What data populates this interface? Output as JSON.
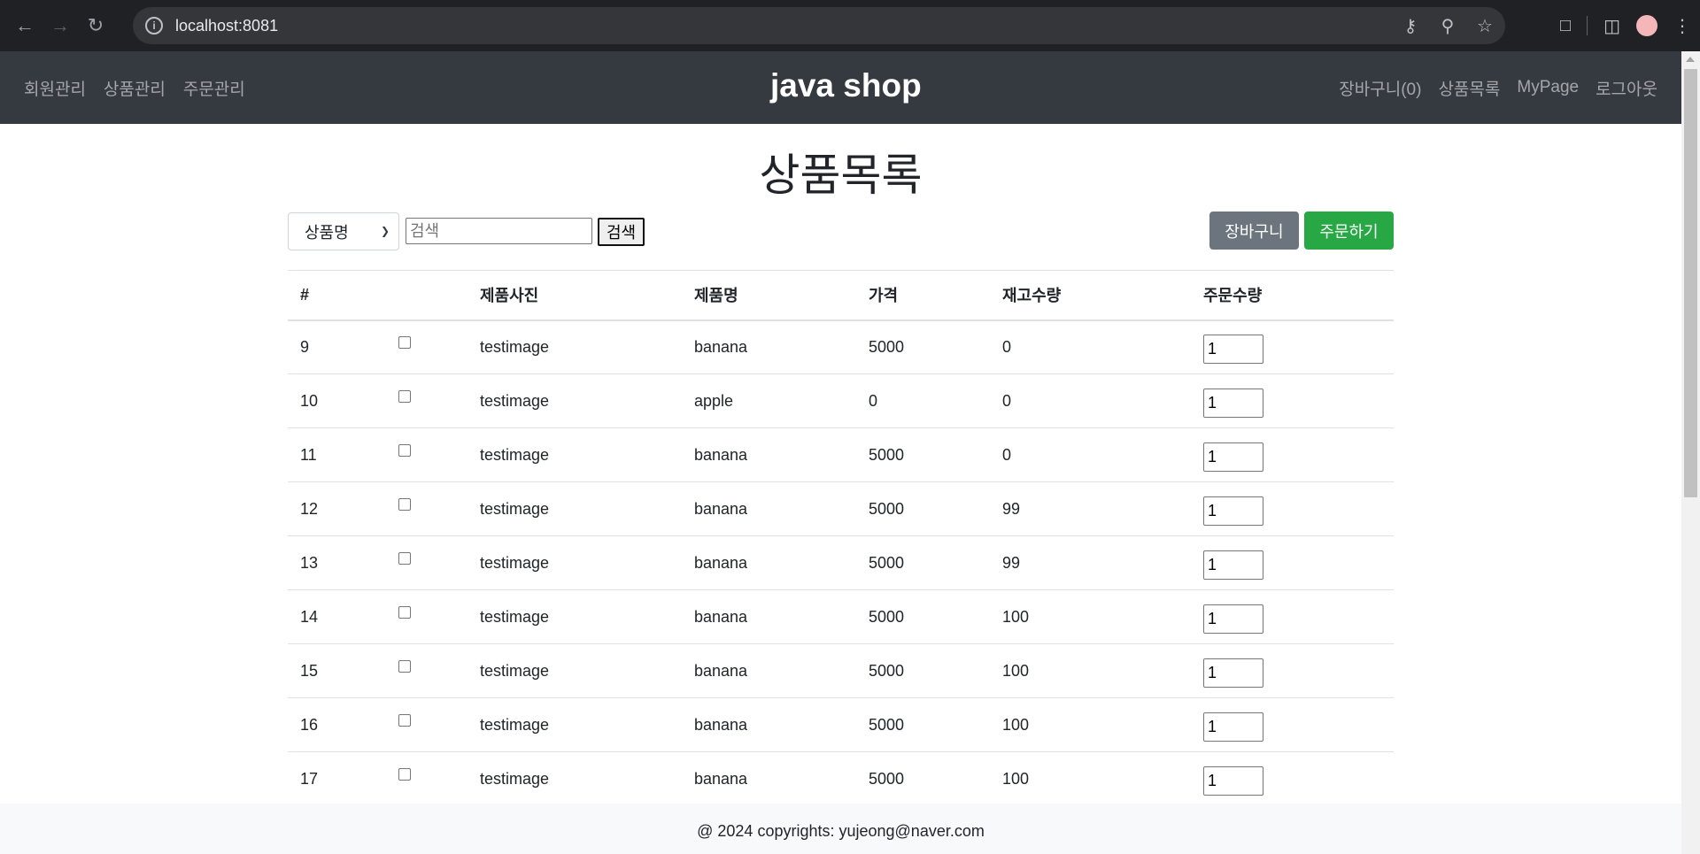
{
  "browser": {
    "url": "localhost:8081"
  },
  "nav": {
    "brand": "java shop",
    "left_links": [
      "회원관리",
      "상품관리",
      "주문관리"
    ],
    "right_links": [
      "장바구니(0)",
      "상품목록",
      "MyPage",
      "로그아웃"
    ]
  },
  "page": {
    "title": "상품목록"
  },
  "search": {
    "select_value": "상품명",
    "placeholder": "검색",
    "button_label": "검색"
  },
  "actions": {
    "cart_label": "장바구니",
    "order_label": "주문하기"
  },
  "table": {
    "headers": [
      "#",
      "",
      "제품사진",
      "제품명",
      "가격",
      "재고수량",
      "주문수량"
    ],
    "rows": [
      {
        "id": "9",
        "image": "testimage",
        "name": "banana",
        "price": "5000",
        "stock": "0",
        "qty": "1"
      },
      {
        "id": "10",
        "image": "testimage",
        "name": "apple",
        "price": "0",
        "stock": "0",
        "qty": "1"
      },
      {
        "id": "11",
        "image": "testimage",
        "name": "banana",
        "price": "5000",
        "stock": "0",
        "qty": "1"
      },
      {
        "id": "12",
        "image": "testimage",
        "name": "banana",
        "price": "5000",
        "stock": "99",
        "qty": "1"
      },
      {
        "id": "13",
        "image": "testimage",
        "name": "banana",
        "price": "5000",
        "stock": "99",
        "qty": "1"
      },
      {
        "id": "14",
        "image": "testimage",
        "name": "banana",
        "price": "5000",
        "stock": "100",
        "qty": "1"
      },
      {
        "id": "15",
        "image": "testimage",
        "name": "banana",
        "price": "5000",
        "stock": "100",
        "qty": "1"
      },
      {
        "id": "16",
        "image": "testimage",
        "name": "banana",
        "price": "5000",
        "stock": "100",
        "qty": "1"
      },
      {
        "id": "17",
        "image": "testimage",
        "name": "banana",
        "price": "5000",
        "stock": "100",
        "qty": "1"
      }
    ]
  },
  "footer": {
    "text": "@ 2024 copyrights: yujeong@naver.com"
  },
  "colors": {
    "navbar": "#343a40",
    "secondary": "#6c757d",
    "success": "#28a745",
    "footer_bg": "#f8f9fa"
  }
}
